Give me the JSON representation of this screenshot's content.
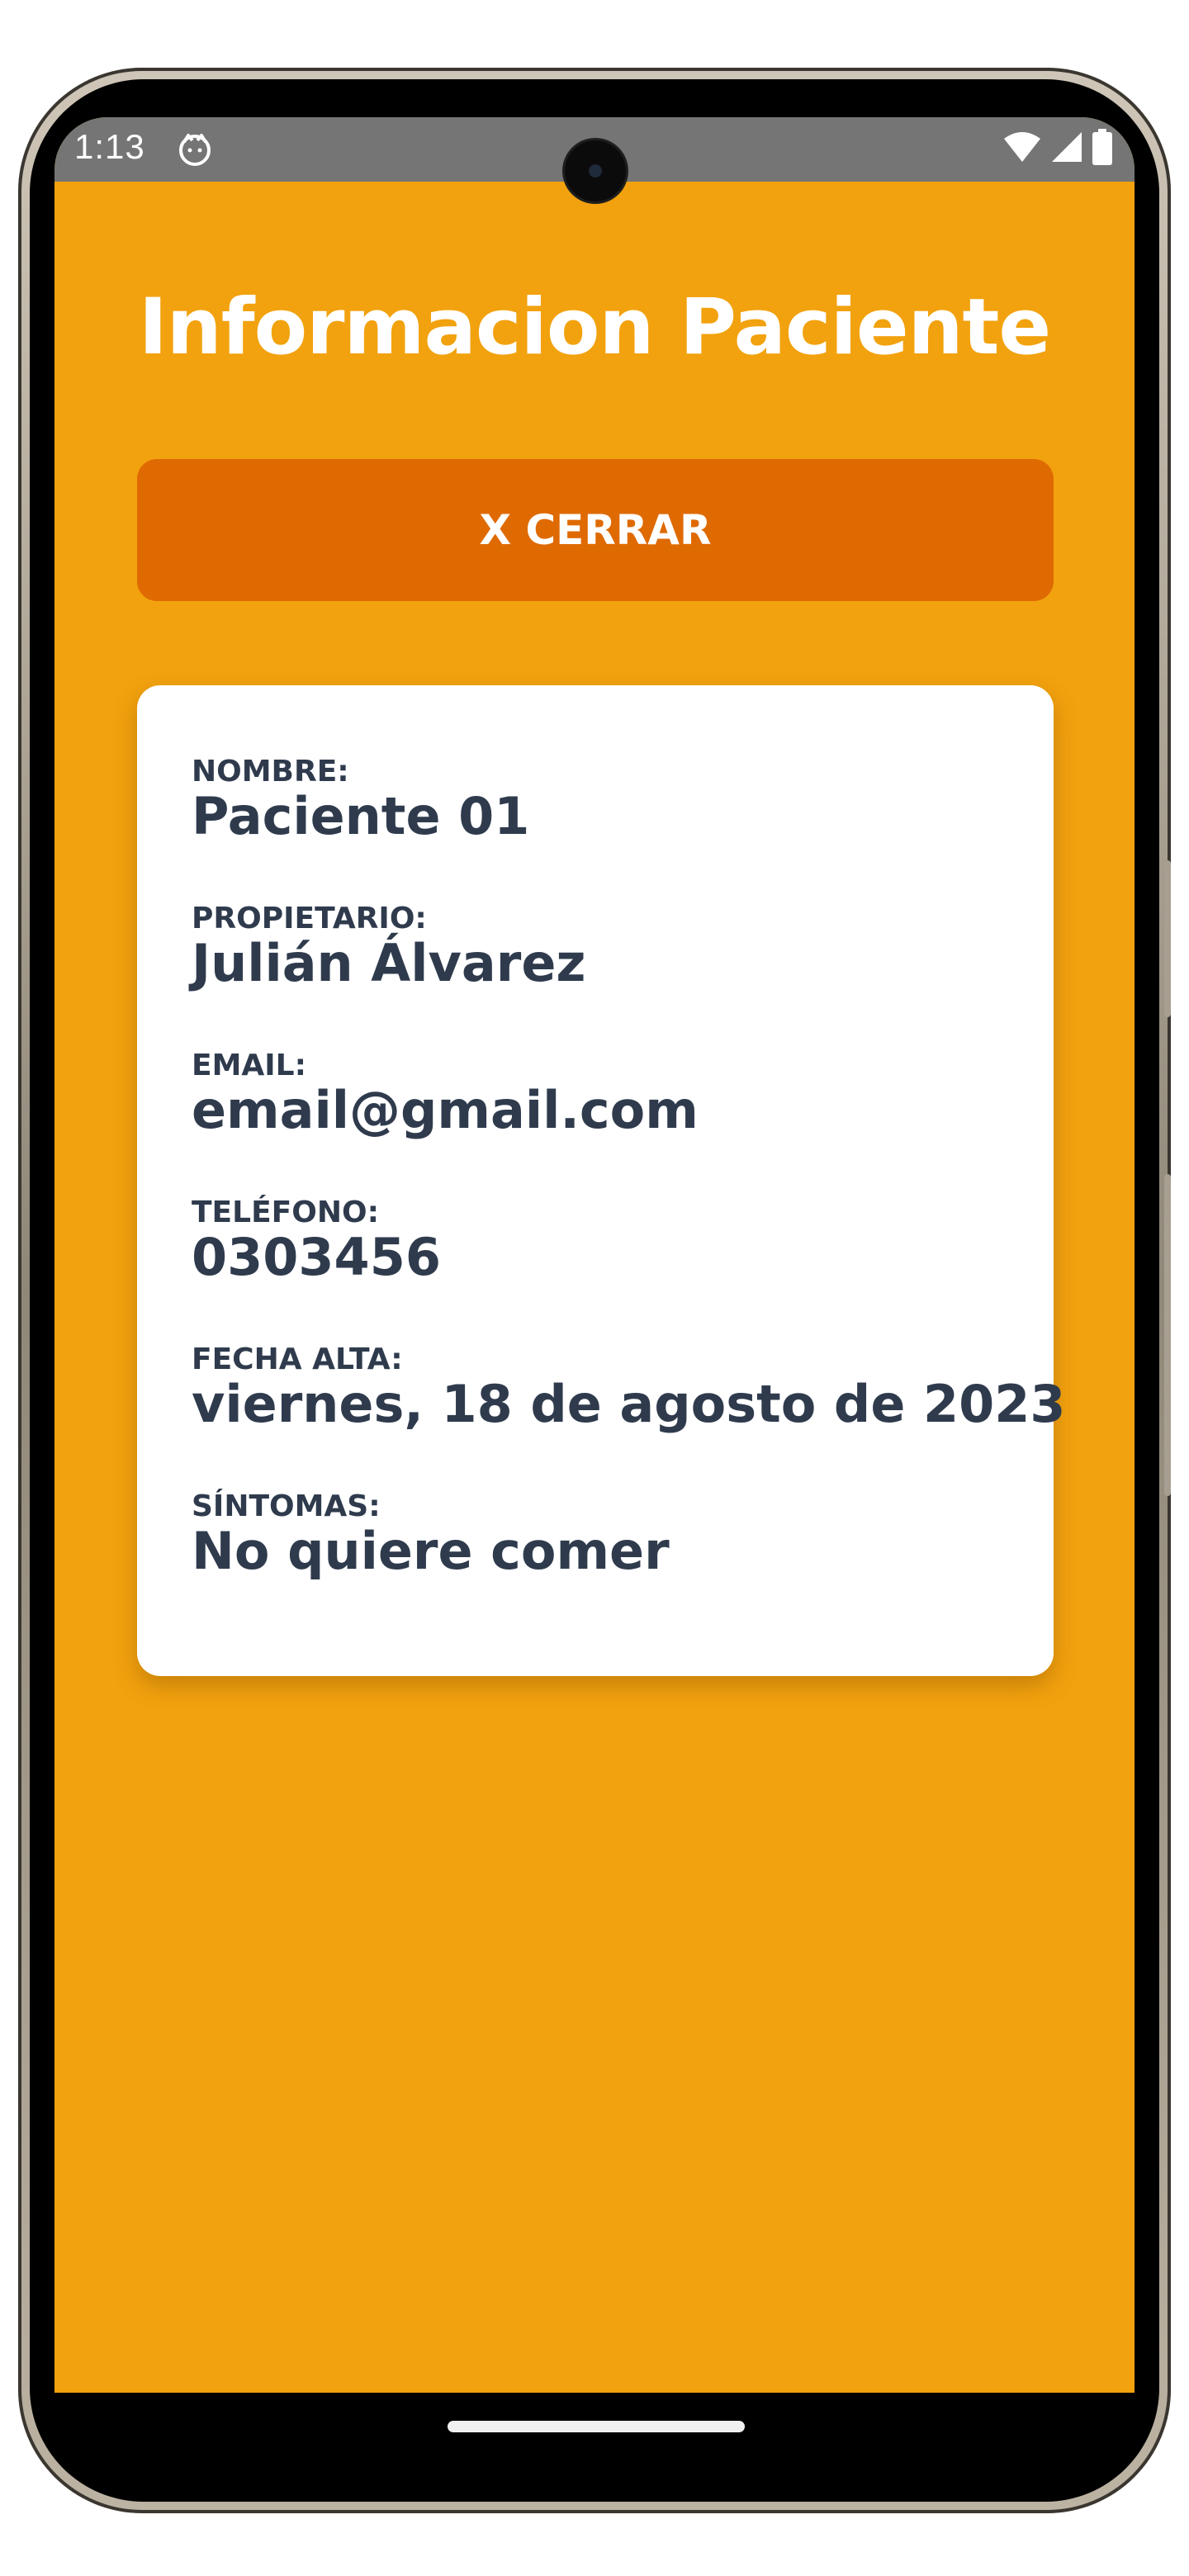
{
  "status_bar": {
    "time": "1:13",
    "icons": [
      "app-notification-icon",
      "wifi-icon",
      "signal-icon",
      "battery-icon"
    ]
  },
  "page": {
    "title": "Informacion Paciente",
    "close_label": "X CERRAR"
  },
  "patient": {
    "fields": [
      {
        "label": "NOMBRE:",
        "value": "Paciente 01"
      },
      {
        "label": "PROPIETARIO:",
        "value": "Julián Álvarez"
      },
      {
        "label": "EMAIL:",
        "value": "email@gmail.com"
      },
      {
        "label": "TELÉFONO:",
        "value": "0303456"
      },
      {
        "label": "FECHA ALTA:",
        "value": "viernes, 18 de agosto de 2023"
      },
      {
        "label": "SÍNTOMAS:",
        "value": "No quiere comer"
      }
    ]
  },
  "colors": {
    "background": "#f2a20e",
    "button": "#df6a02",
    "card": "#ffffff",
    "text_dark": "#2f3b4d",
    "status_bar": "#757575"
  }
}
